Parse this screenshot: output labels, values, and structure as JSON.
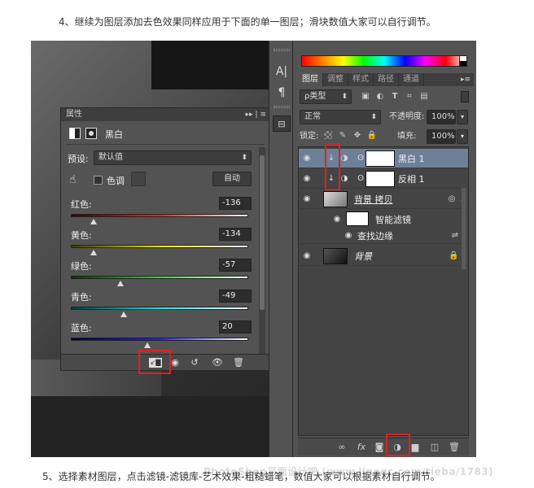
{
  "captions": {
    "top": "4、继续为图层添加去色效果同样应用于下面的单一图层；滑块数值大家可以自行调节。",
    "bottom": "5、选择素材图层，点击滤镜-滤镜库-艺术效果-粗糙蜡笔，数值大家可以根据素材自行调节。",
    "watermark": "PhotoShop平面设计吧 (www.lineec.com/tieba/1783)"
  },
  "strip": {
    "text_tool_glyph": "A|",
    "para_glyph": "¶"
  },
  "panels": {
    "tabs": [
      "图层",
      "调整",
      "样式",
      "路径",
      "通道"
    ],
    "tabs_menu": "▸≡",
    "kind_filter": "ρ类型",
    "blend_mode": "正常",
    "opacity_label": "不透明度:",
    "opacity_value": "100%",
    "lock_label": "锁定:",
    "fill_label": "填充:",
    "fill_value": "100%",
    "layers": [
      {
        "name": "黑白 1"
      },
      {
        "name": "反相 1"
      },
      {
        "name": "背景 拷贝"
      },
      {
        "name": "智能滤镜"
      },
      {
        "name": "查找边缘"
      },
      {
        "name": "背景"
      }
    ],
    "footer_icons": [
      "link-icon",
      "fx-icon",
      "mask-icon",
      "adjustment-icon",
      "folder-icon",
      "new-layer-icon",
      "trash-icon"
    ]
  },
  "properties": {
    "title": "属性",
    "header_menu": "▸▸ | ≡",
    "adjustment_name": "黑白",
    "preset_label": "预设:",
    "preset_value": "默认值",
    "tint_label": "色调",
    "auto_button": "自动",
    "sliders": [
      {
        "label": "红色:",
        "value": "-136",
        "fraction": 0.13,
        "gradient": "linear-gradient(90deg,#3a0000,#ff2020,#ffffff)"
      },
      {
        "label": "黄色:",
        "value": "-134",
        "fraction": 0.13,
        "gradient": "linear-gradient(90deg,#3a3a00,#e6e600,#ffffff)"
      },
      {
        "label": "绿色:",
        "value": "-57",
        "fraction": 0.28,
        "gradient": "linear-gradient(90deg,#003a00,#20e020,#ffffff)"
      },
      {
        "label": "青色:",
        "value": "-49",
        "fraction": 0.3,
        "gradient": "linear-gradient(90deg,#003a3a,#20e0e0,#ffffff)"
      },
      {
        "label": "蓝色:",
        "value": "20",
        "fraction": 0.43,
        "gradient": "linear-gradient(90deg,#00003a,#2020ff,#ffffff)"
      }
    ]
  },
  "colors": {
    "highlight": "#e02020",
    "selected_row": "#6e7f98"
  }
}
